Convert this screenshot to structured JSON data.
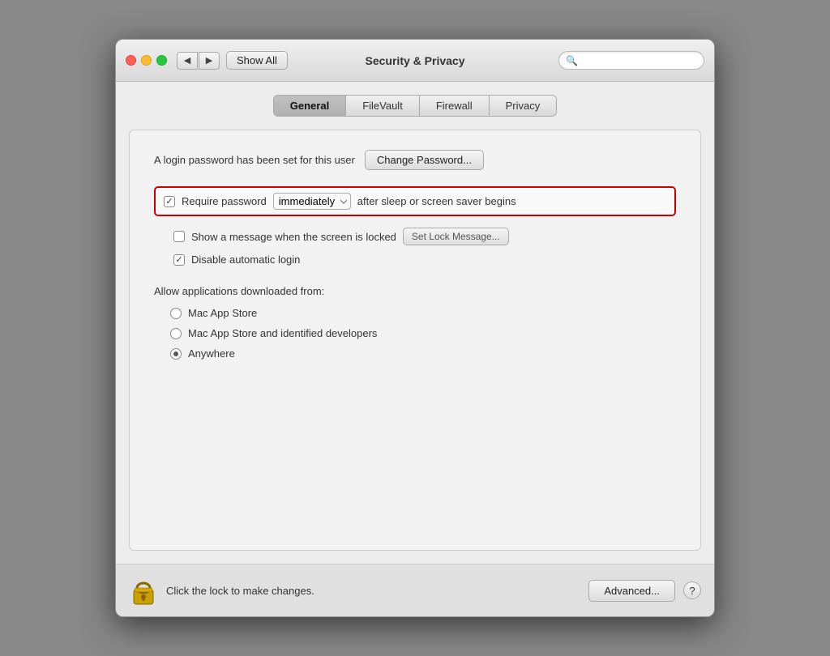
{
  "window": {
    "title": "Security & Privacy"
  },
  "titlebar": {
    "show_all_label": "Show All",
    "search_placeholder": "Q"
  },
  "tabs": [
    {
      "id": "general",
      "label": "General",
      "active": true
    },
    {
      "id": "filevault",
      "label": "FileVault",
      "active": false
    },
    {
      "id": "firewall",
      "label": "Firewall",
      "active": false
    },
    {
      "id": "privacy",
      "label": "Privacy",
      "active": false
    }
  ],
  "general": {
    "login_password_text": "A login password has been set for this user",
    "change_password_label": "Change Password...",
    "require_password_label": "Require password",
    "immediately_option": "immediately",
    "after_sleep_text": "after sleep or screen saver begins",
    "show_message_label": "Show a message when the screen is locked",
    "set_lock_message_label": "Set Lock Message...",
    "disable_autologin_label": "Disable automatic login",
    "allow_apps_label": "Allow applications downloaded from:",
    "radio_options": [
      {
        "id": "mac-app-store",
        "label": "Mac App Store",
        "selected": false
      },
      {
        "id": "mac-app-store-identified",
        "label": "Mac App Store and identified developers",
        "selected": false
      },
      {
        "id": "anywhere",
        "label": "Anywhere",
        "selected": true
      }
    ]
  },
  "bottom_bar": {
    "lock_text": "Click the lock to make changes.",
    "advanced_label": "Advanced...",
    "help_label": "?"
  },
  "icons": {
    "back": "◀",
    "forward": "▶",
    "search": "🔍"
  }
}
